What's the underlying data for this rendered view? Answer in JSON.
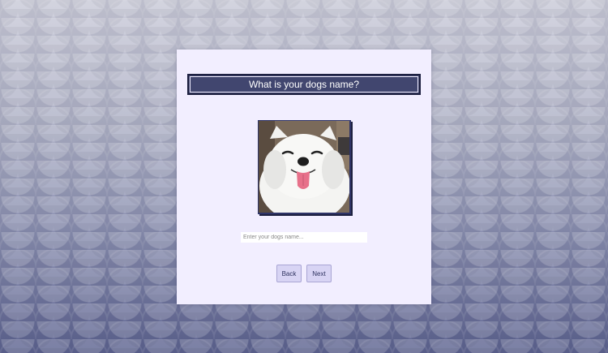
{
  "card": {
    "title": "What is your dogs name?"
  },
  "photo": {
    "icon": "dog-photo"
  },
  "name_input": {
    "placeholder": "Enter your dogs name...",
    "value": ""
  },
  "buttons": {
    "back_label": "Back",
    "next_label": "Next"
  },
  "colors": {
    "title_bar": "#41466f",
    "card_bg": "#f2eeff",
    "button_bg": "#d8d4f4"
  }
}
